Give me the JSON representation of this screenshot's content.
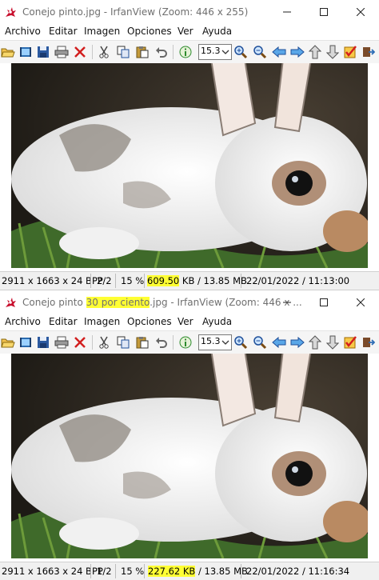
{
  "windows": [
    {
      "title": {
        "prefix": "Conejo pinto.jpg",
        "highlight": "",
        "suffix": " - IrfanView (Zoom: 446 x 255)"
      },
      "menu": [
        "Archivo",
        "Editar",
        "Imagen",
        "Opciones",
        "Ver",
        "Ayuda"
      ],
      "zoom_value": "15.3",
      "status": {
        "dimensions": "2911 x 1663 x 24 BPP",
        "index": "2/2",
        "zoom": "15 %",
        "size_value": "609.50",
        "size_rest": " KB / 13.85 MB",
        "datetime": "22/01/2022 / 11:13:00"
      }
    },
    {
      "title": {
        "prefix": "Conejo pinto ",
        "highlight": "30 por ciento",
        "suffix": ".jpg - IrfanView (Zoom: 446 x ..."
      },
      "menu": [
        "Archivo",
        "Editar",
        "Imagen",
        "Opciones",
        "Ver",
        "Ayuda"
      ],
      "zoom_value": "15.3",
      "status": {
        "dimensions": "2911 x 1663 x 24 BPP",
        "index": "1/2",
        "zoom": "15 %",
        "size_value": "227.62 KB",
        "size_rest": " / 13.85 MB",
        "datetime": "22/01/2022 / 11:16:34"
      }
    }
  ],
  "toolbar_icons": [
    "open-folder-icon",
    "slideshow-icon",
    "save-icon",
    "print-icon",
    "delete-icon",
    "cut-icon",
    "copy-icon",
    "paste-icon",
    "undo-icon",
    "info-icon",
    "zoom-in-icon",
    "zoom-out-icon",
    "previous-icon",
    "next-icon",
    "first-icon",
    "last-icon",
    "options-icon",
    "exit-icon"
  ],
  "colors": {
    "highlight": "#ffff33",
    "title_text": "#6f6f6f",
    "toolbar_bg": "#f5f5f5",
    "status_bg": "#f0f0f0"
  }
}
